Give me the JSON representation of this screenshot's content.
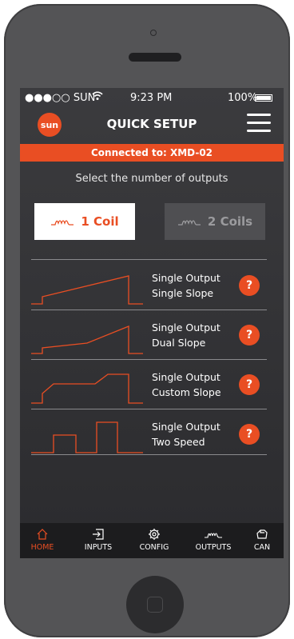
{
  "status_bar": {
    "carrier": "●●●○○ SUN",
    "time": "9:23 PM",
    "battery": "100%"
  },
  "header": {
    "logo": "sun",
    "title": "QUICK SETUP",
    "menu_icon": "hamburger-icon"
  },
  "banner": {
    "text": "Connected to: XMD-02"
  },
  "prompt": "Select the number of outputs",
  "coil_buttons": [
    {
      "label": "1 Coil",
      "selected": true
    },
    {
      "label": "2 Coils",
      "selected": false
    }
  ],
  "options": [
    {
      "line1": "Single Output",
      "line2": "Single Slope",
      "help": "?"
    },
    {
      "line1": "Single Output",
      "line2": "Dual Slope",
      "help": "?"
    },
    {
      "line1": "Single Output",
      "line2": "Custom Slope",
      "help": "?"
    },
    {
      "line1": "Single Output",
      "line2": "Two Speed",
      "help": "?"
    }
  ],
  "tabs": [
    {
      "label": "HOME",
      "icon": "home-icon",
      "active": true
    },
    {
      "label": "INPUTS",
      "icon": "inputs-icon",
      "active": false
    },
    {
      "label": "CONFIG",
      "icon": "gear-icon",
      "active": false
    },
    {
      "label": "OUTPUTS",
      "icon": "coil-icon",
      "active": false
    },
    {
      "label": "CAN",
      "icon": "can-icon",
      "active": false
    }
  ],
  "colors": {
    "accent": "#e94e23",
    "background": "#333336",
    "phone_body": "#545456"
  }
}
